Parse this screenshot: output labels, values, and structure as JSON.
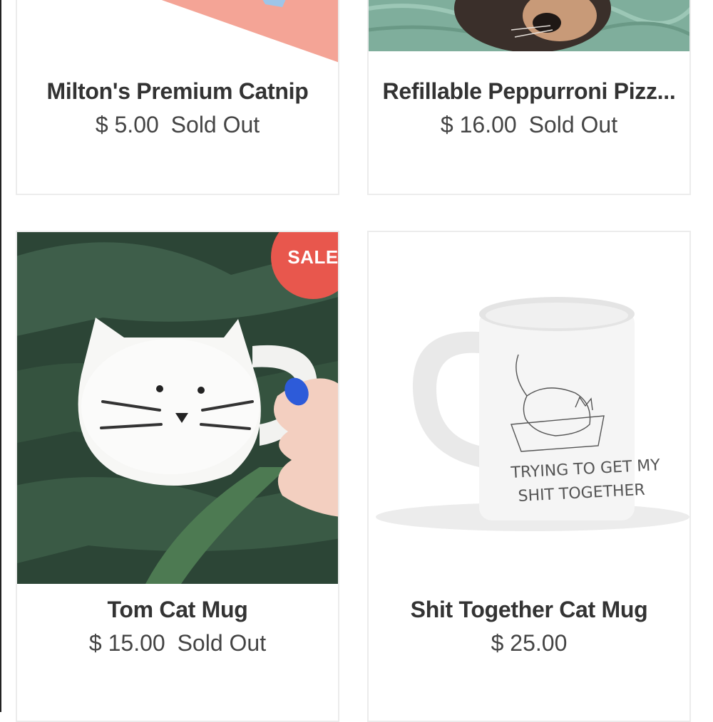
{
  "products": [
    {
      "title": "Milton's Premium Catnip",
      "price": "$ 5.00",
      "status": "Sold Out"
    },
    {
      "title": "Refillable Peppurroni Pizz...",
      "price": "$ 16.00",
      "status": "Sold Out"
    },
    {
      "title": "Tom Cat Mug",
      "price": "$ 15.00",
      "status": "Sold Out",
      "badge": "SALE"
    },
    {
      "title": "Shit Together Cat Mug",
      "price": "$ 25.00",
      "status": ""
    }
  ],
  "colors": {
    "sale_badge": "#e8574d",
    "card_border": "#ececec",
    "text": "#333333"
  }
}
